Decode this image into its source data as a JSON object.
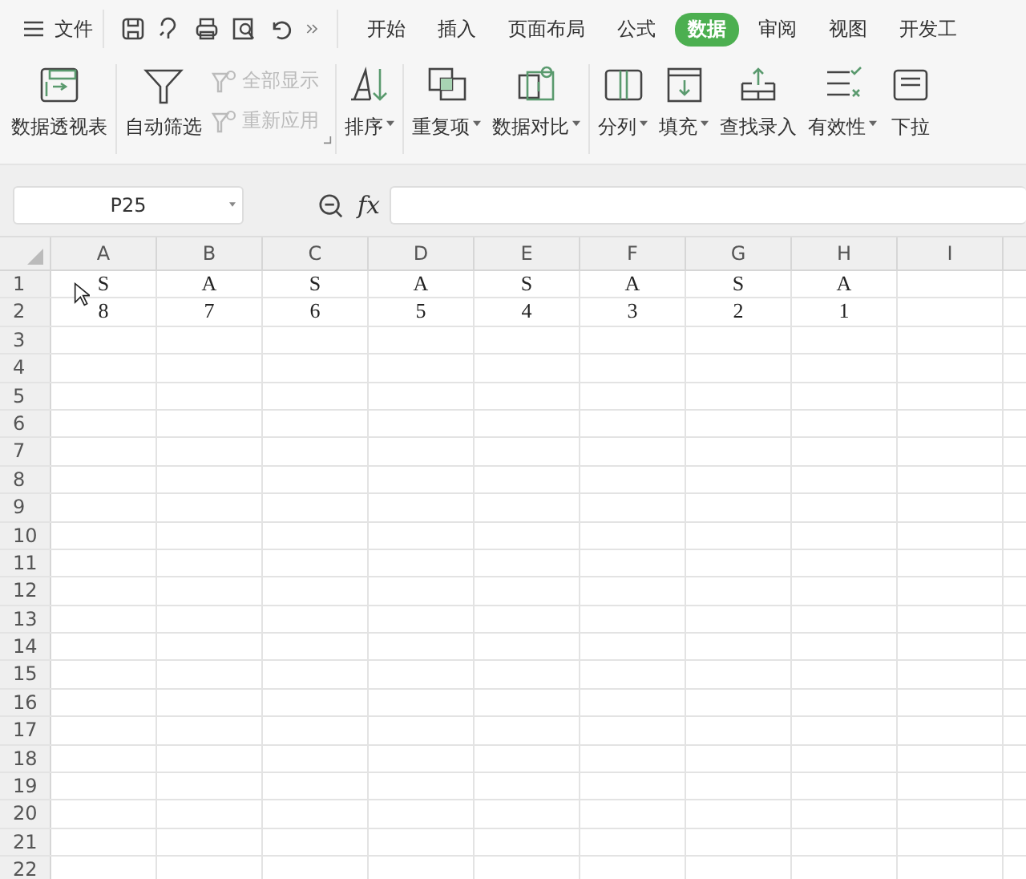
{
  "menu_bar": {
    "file_label": "文件",
    "tabs": [
      {
        "label": "开始",
        "selected": false
      },
      {
        "label": "插入",
        "selected": false
      },
      {
        "label": "页面布局",
        "selected": false
      },
      {
        "label": "公式",
        "selected": false
      },
      {
        "label": "数据",
        "selected": true
      },
      {
        "label": "审阅",
        "selected": false
      },
      {
        "label": "视图",
        "selected": false
      },
      {
        "label": "开发工",
        "selected": false
      }
    ]
  },
  "ribbon": {
    "groups": [
      {
        "items": [
          {
            "kind": "large",
            "label": "数据透视表",
            "disabled": false,
            "has_menu": false
          }
        ]
      },
      {
        "items": [
          {
            "kind": "large",
            "label": "自动筛选",
            "disabled": false,
            "has_menu": false
          },
          {
            "kind": "stack",
            "children": [
              {
                "label": "全部显示",
                "disabled": true
              },
              {
                "label": "重新应用",
                "disabled": true
              }
            ]
          }
        ]
      },
      {
        "items": [
          {
            "kind": "large",
            "label": "排序",
            "disabled": false,
            "has_menu": true
          }
        ]
      },
      {
        "items": [
          {
            "kind": "large",
            "label": "重复项",
            "disabled": false,
            "has_menu": true
          },
          {
            "kind": "large",
            "label": "数据对比",
            "disabled": false,
            "has_menu": true
          }
        ]
      },
      {
        "items": [
          {
            "kind": "large",
            "label": "分列",
            "disabled": false,
            "has_menu": true
          },
          {
            "kind": "large",
            "label": "填充",
            "disabled": false,
            "has_menu": true
          },
          {
            "kind": "large",
            "label": "查找录入",
            "disabled": false,
            "has_menu": false
          },
          {
            "kind": "large",
            "label": "有效性",
            "disabled": false,
            "has_menu": true
          },
          {
            "kind": "large",
            "label": "下拉",
            "disabled": false,
            "has_menu": false
          }
        ]
      }
    ]
  },
  "formula_bar": {
    "name_box": "P25",
    "formula_label": "fx"
  },
  "sheet": {
    "columns": [
      "A",
      "B",
      "C",
      "D",
      "E",
      "F",
      "G",
      "H",
      "I"
    ],
    "rows": [
      {
        "number": "1",
        "cells": [
          "S",
          "A",
          "S",
          "A",
          "S",
          "A",
          "S",
          "A"
        ]
      },
      {
        "number": "2",
        "cells": [
          "8",
          "7",
          "6",
          "5",
          "4",
          "3",
          "2",
          "1"
        ]
      },
      {
        "number": "3",
        "cells": []
      },
      {
        "number": "4",
        "cells": []
      },
      {
        "number": "5",
        "cells": []
      },
      {
        "number": "6",
        "cells": []
      },
      {
        "number": "7",
        "cells": []
      },
      {
        "number": "8",
        "cells": []
      },
      {
        "number": "9",
        "cells": []
      },
      {
        "number": "10",
        "cells": []
      },
      {
        "number": "11",
        "cells": []
      },
      {
        "number": "12",
        "cells": []
      },
      {
        "number": "13",
        "cells": []
      },
      {
        "number": "14",
        "cells": []
      },
      {
        "number": "15",
        "cells": []
      },
      {
        "number": "16",
        "cells": []
      },
      {
        "number": "17",
        "cells": []
      },
      {
        "number": "18",
        "cells": []
      },
      {
        "number": "19",
        "cells": []
      },
      {
        "number": "20",
        "cells": []
      },
      {
        "number": "21",
        "cells": []
      },
      {
        "number": "22",
        "cells": []
      }
    ]
  }
}
